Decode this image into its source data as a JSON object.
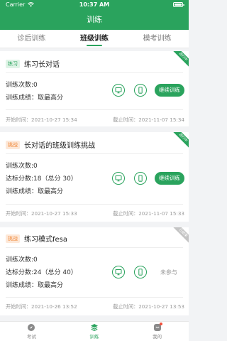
{
  "status": {
    "time": "10:37 AM",
    "carrier": "Carrier"
  },
  "header": {
    "title": "训练"
  },
  "tabs": [
    {
      "label": "诊后训练"
    },
    {
      "label": "班级训练"
    },
    {
      "label": "模考训练"
    }
  ],
  "cards": [
    {
      "badge": "练习",
      "title": "练习长对话",
      "ribbon": "进行中",
      "stats": [
        "训练次数:0",
        "训练成绩：取最高分"
      ],
      "start": "开始时间：2021-10-27 15:34",
      "end": "截止时间：2021-11-07 15:34",
      "action": "继续训练"
    },
    {
      "badge": "挑战",
      "title": "长对话的班级训练挑战",
      "ribbon": "进行中",
      "stats": [
        "训练次数:0",
        "达标分数:18（总分 30）",
        "训练成绩：取最高分"
      ],
      "start": "开始时间：2021-10-27 15:33",
      "end": "截止时间：2021-11-07 15:33",
      "action": "继续训练"
    },
    {
      "badge": "挑战",
      "title": "练习模式fesa",
      "ribbon": "已结束",
      "stats": [
        "训练次数:0",
        "达标分数:24（总分 40）",
        "训练成绩：取最高分"
      ],
      "start": "开始时间：2021-10-26 13:52",
      "end": "截止时间：2021-10-27 13:53",
      "action": "未参与"
    }
  ],
  "bottom_nav": [
    {
      "label": "考试",
      "icon": "compass-icon"
    },
    {
      "label": "训练",
      "icon": "layers-icon"
    },
    {
      "label": "我的",
      "icon": "profile-icon"
    }
  ],
  "colors": {
    "primary": "#2aa35d",
    "challenge": "#f08a3c",
    "inactive": "#c4c4c4"
  }
}
